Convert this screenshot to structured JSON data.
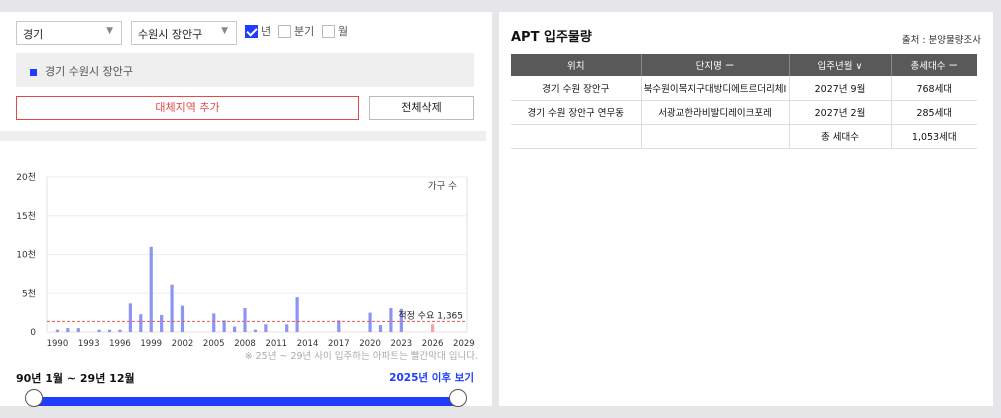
{
  "filters": {
    "province": "경기",
    "city": "수원시 장안구",
    "period_options": [
      {
        "label": "년",
        "checked": true
      },
      {
        "label": "분기",
        "checked": false
      },
      {
        "label": "월",
        "checked": false
      }
    ]
  },
  "region_item": "경기 수원시 장안구",
  "buttons": {
    "add_region": "대체지역 추가",
    "clear_all": "전체삭제"
  },
  "chart_data": {
    "type": "bar",
    "y_unit_label": "가구 수",
    "y_ticks": [
      "0",
      "5천",
      "10천",
      "15천",
      "20천"
    ],
    "x_ticks": [
      "1990",
      "1993",
      "1996",
      "1999",
      "2002",
      "2005",
      "2008",
      "2011",
      "2014",
      "2017",
      "2020",
      "2023",
      "2026",
      "2029"
    ],
    "ylim": [
      0,
      20000
    ],
    "x": [
      1990,
      1991,
      1992,
      1993,
      1994,
      1995,
      1996,
      1997,
      1998,
      1999,
      2000,
      2001,
      2002,
      2003,
      2004,
      2005,
      2006,
      2007,
      2008,
      2009,
      2010,
      2011,
      2012,
      2013,
      2014,
      2015,
      2016,
      2017,
      2018,
      2019,
      2020,
      2021,
      2022,
      2023,
      2024,
      2025,
      2026,
      2027,
      2028,
      2029
    ],
    "values": [
      300,
      500,
      500,
      0,
      300,
      300,
      300,
      3700,
      2300,
      11000,
      2200,
      6100,
      3400,
      0,
      0,
      2400,
      1500,
      700,
      3100,
      300,
      1000,
      0,
      1000,
      4500,
      0,
      0,
      0,
      1500,
      0,
      0,
      2500,
      900,
      3100,
      3000,
      0,
      0,
      1000,
      0,
      0,
      0
    ],
    "highlight_from": 2025,
    "bar_color": "#8c96f2",
    "highlight_color": "#f4a6a6",
    "reference": {
      "label": "적정 수요 1,365",
      "value": 1365,
      "color": "#e35a5a"
    }
  },
  "note": "※ 25년 ~ 29년 사이 입주하는 아파트는 빨간막대 입니다.",
  "range_label": "90년 1월 ~ 29년 12월",
  "after_link": "2025년 이후 보기",
  "right_panel": {
    "title": "APT 입주물량",
    "source": "출처 : 분양물량조사",
    "headers": [
      "위치",
      "단지명 ー",
      "입주년월 ∨",
      "총세대수 ー"
    ],
    "rows": [
      [
        "경기 수원 장안구",
        "북수원이목지구대방디에트르더리체Ⅰ",
        "2027년 9월",
        "768세대"
      ],
      [
        "경기 수원 장안구 연무동",
        "서광교한라비발디레이크포레",
        "2027년 2월",
        "285세대"
      ],
      [
        "",
        "",
        "총 세대수",
        "1,053세대"
      ]
    ]
  }
}
